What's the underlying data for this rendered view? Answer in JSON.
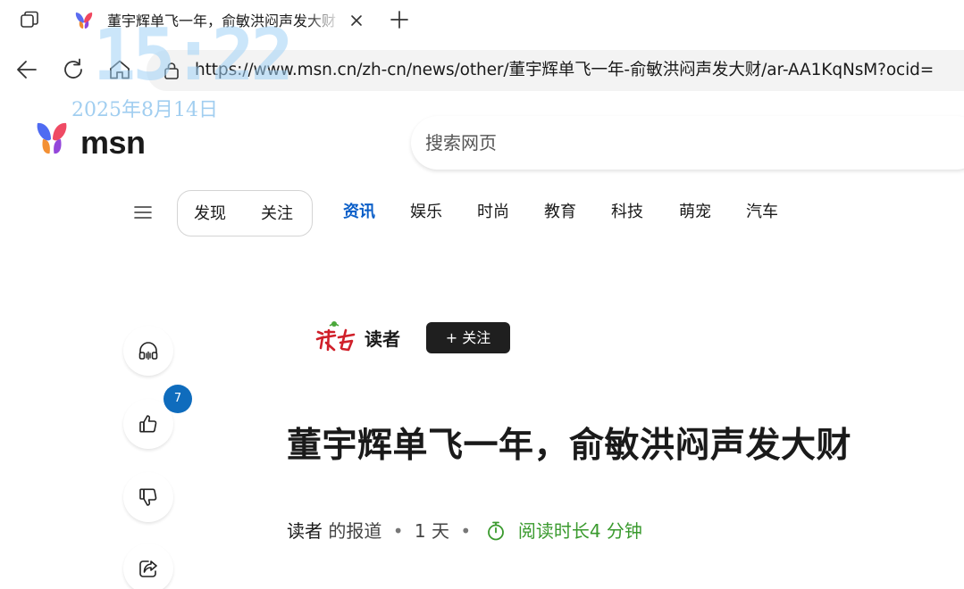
{
  "browser": {
    "tab": {
      "title": "董宇辉单飞一年，俞敏洪闷声发大财 - MSN"
    },
    "url": "https://www.msn.cn/zh-cn/news/other/董宇辉单飞一年-俞敏洪闷声发大财/ar-AA1KqNsM?ocid=",
    "icons": {
      "tab_actions": "tab-actions-icon",
      "close": "close-icon",
      "new_tab": "plus-icon",
      "back": "back-arrow-icon",
      "refresh": "refresh-icon",
      "home": "home-icon",
      "lock": "lock-icon"
    }
  },
  "clock_overlay": {
    "time": "15:22",
    "date": "2025年8月14日"
  },
  "msn": {
    "brand": "msn",
    "search_placeholder": "搜索网页",
    "pill": [
      "发现",
      "关注"
    ],
    "categories": [
      "资讯",
      "娱乐",
      "时尚",
      "教育",
      "科技",
      "萌宠",
      "汽车"
    ],
    "active_category": "资讯",
    "accent_color": "#0a5ec8"
  },
  "rail": {
    "like_count": "7",
    "icons": [
      "headphones-icon",
      "thumbs-up-icon",
      "thumbs-down-icon",
      "share-icon"
    ]
  },
  "article": {
    "publisher": "读者",
    "follow_label": "+ 关注",
    "headline": "董宇辉单飞一年，俞敏洪闷声发大财",
    "byline": {
      "source": "读者",
      "source_suffix": "的报道",
      "dot": "•",
      "age": "1 天",
      "read_time": "阅读时长4 分钟"
    },
    "read_time_color": "#3a9a2e"
  }
}
